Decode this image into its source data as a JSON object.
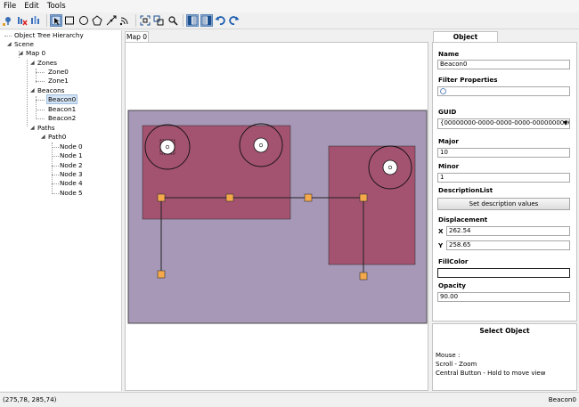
{
  "menu": [
    "File",
    "Edit",
    "Tools"
  ],
  "toolbar": {
    "tools": [
      {
        "name": "add-beacon-tool-icon",
        "active": false
      },
      {
        "name": "delete-beacon-tool-icon",
        "active": false
      },
      {
        "name": "signal-tool-icon",
        "active": false
      },
      {
        "name": "select-tool-icon",
        "active": true
      },
      {
        "name": "rectangle-tool-icon",
        "active": false
      },
      {
        "name": "circle-tool-icon",
        "active": false
      },
      {
        "name": "polygon-tool-icon",
        "active": false
      },
      {
        "name": "path-tool-icon",
        "active": false
      },
      {
        "name": "wifi-tool-icon",
        "active": false
      },
      {
        "name": "fit-view-icon",
        "active": false
      },
      {
        "name": "zoom-area-icon",
        "active": false
      },
      {
        "name": "zoom-icon",
        "active": false
      },
      {
        "name": "layout-tree-icon",
        "active": true
      },
      {
        "name": "layout-properties-icon",
        "active": true
      },
      {
        "name": "undo-icon",
        "active": false
      },
      {
        "name": "redo-icon",
        "active": false
      }
    ]
  },
  "tree": {
    "header": "Object Tree Hierarchy",
    "scene": "Scene",
    "map": "Map 0",
    "zones": "Zones",
    "zone_items": [
      "Zone0",
      "Zone1"
    ],
    "beacons": "Beacons",
    "beacon_items": [
      "Beacon0",
      "Beacon1",
      "Beacon2"
    ],
    "selected_beacon": "Beacon0",
    "paths": "Paths",
    "path": "Path0",
    "node_items": [
      "Node 0",
      "Node 1",
      "Node 2",
      "Node 3",
      "Node 4",
      "Node 5"
    ]
  },
  "map_tab": "Map 0",
  "props": {
    "tab": "Object Properties",
    "name_label": "Name",
    "name_value": "Beacon0",
    "filter_label": "Filter Properties",
    "guid_label": "GUID",
    "guid_value": "{00000000-0000-0000-0000-000000000000}",
    "major_label": "Major",
    "major_value": "10",
    "minor_label": "Minor",
    "minor_value": "1",
    "desc_label": "DescriptionList",
    "desc_button": "Set description values",
    "displacement_label": "Displacement",
    "x_label": "X",
    "x_value": "262.54",
    "y_label": "Y",
    "y_value": "258.65",
    "fill_label": "FillColor",
    "opacity_label": "Opacity",
    "opacity_value": "90.00"
  },
  "select_panel": {
    "title": "Select Object",
    "line1": "Mouse :",
    "line2": "Scroll - Zoom",
    "line3": "Central Button - Hold to move view"
  },
  "status": {
    "coords": "(275,78, 285,74)",
    "selected": "Beacon0"
  },
  "colors": {
    "map_bg": "#a898b8",
    "zone_fill": "#a24a68",
    "node_fill": "#f5a94a",
    "path_line": "#222222",
    "selection": "#cfe0f4"
  }
}
